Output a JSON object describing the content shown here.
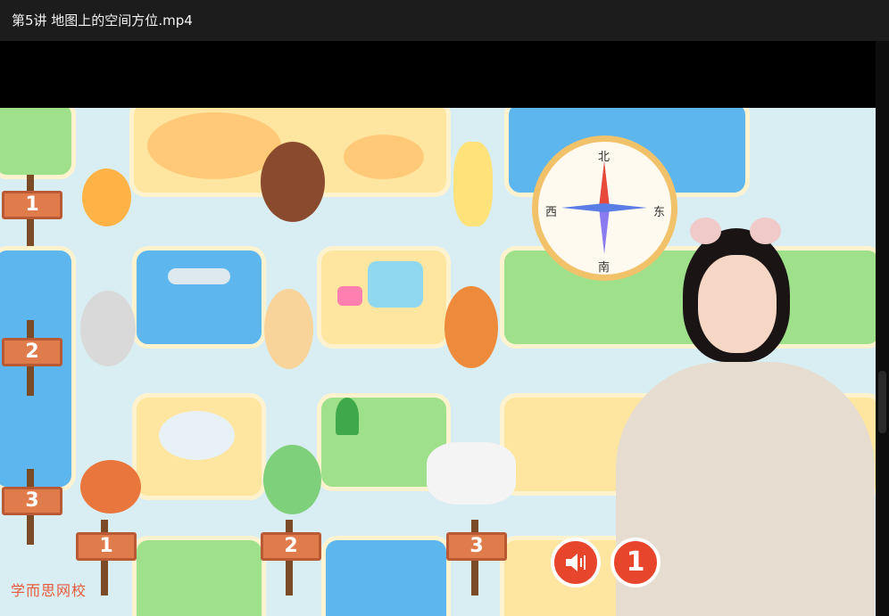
{
  "window": {
    "title": "第5讲 地图上的空间方位.mp4"
  },
  "compass": {
    "north": "北",
    "south": "南",
    "east": "东",
    "west": "西"
  },
  "signs": {
    "left_1": "1",
    "left_2": "2",
    "left_3": "3",
    "bottom_1": "1",
    "bottom_2": "2",
    "bottom_3": "3"
  },
  "controls": {
    "replay_label": "1",
    "sound_icon": "speaker-icon"
  },
  "logo": {
    "text": "学而思网校"
  },
  "colors": {
    "accent": "#e8452d",
    "water": "#5db6ee",
    "sand": "#ffe6a0",
    "grass": "#9fe08a"
  }
}
